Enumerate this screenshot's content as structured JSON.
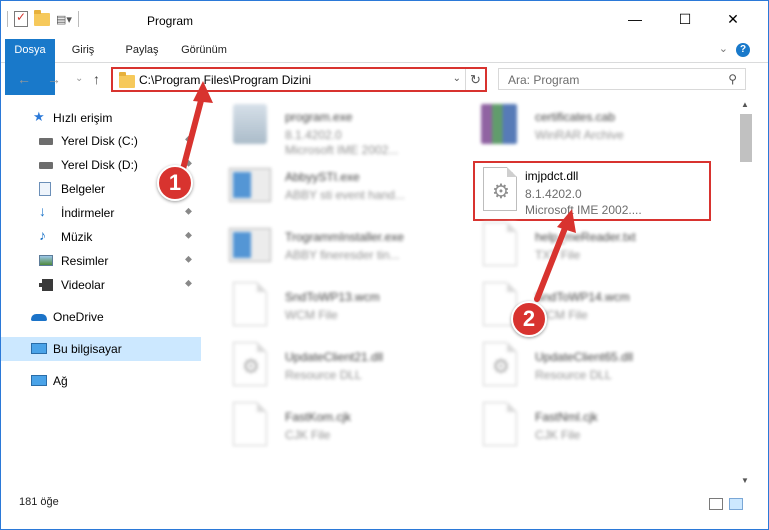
{
  "window": {
    "title": "Program",
    "minimize": "—",
    "maximize": "☐",
    "close": "✕"
  },
  "ribbon": {
    "tabs": [
      "Dosya",
      "Giriş",
      "Paylaş",
      "Görünüm"
    ],
    "help": "?",
    "collapse": "⌄"
  },
  "nav": {
    "back": "←",
    "forward": "→",
    "recent": "⌄",
    "up": "↑"
  },
  "address": {
    "path": "C:\\Program Files\\Program Dizini",
    "dropdown": "⌄",
    "refresh": "↻"
  },
  "search": {
    "placeholder": "Ara: Program",
    "icon": "⚲"
  },
  "sidebar": {
    "items": [
      {
        "label": "Hızlı erişim",
        "icon": "star-icon"
      },
      {
        "label": "Yerel Disk (C:)",
        "icon": "drive-icon"
      },
      {
        "label": "Yerel Disk (D:)",
        "icon": "drive-icon"
      },
      {
        "label": "Belgeler",
        "icon": "documents-icon"
      },
      {
        "label": "İndirmeler",
        "icon": "download-icon"
      },
      {
        "label": "Müzik",
        "icon": "music-icon"
      },
      {
        "label": "Resimler",
        "icon": "pictures-icon"
      },
      {
        "label": "Videolar",
        "icon": "videos-icon"
      },
      {
        "label": "OneDrive",
        "icon": "cloud-icon"
      },
      {
        "label": "Bu bilgisayar",
        "icon": "computer-icon"
      },
      {
        "label": "Ağ",
        "icon": "network-icon"
      }
    ],
    "pin": "📌"
  },
  "files": [
    {
      "name": "program.exe",
      "line1": "8.1.4202.0",
      "line2": "Microsoft IME 2002..."
    },
    {
      "name": "certificates.cab",
      "line1": "WinRAR Archive",
      "line2": ""
    },
    {
      "name": "AbbyySTI.exe",
      "line1": "ABBY sti event hand...",
      "line2": ""
    },
    {
      "name": "imjpdct.dll",
      "line1": "8.1.4202.0",
      "line2": "Microsoft IME 2002...."
    },
    {
      "name": "TrogrammInstaller.exe",
      "line1": "ABBY fineresder tin...",
      "line2": ""
    },
    {
      "name": "help_meReader.txt",
      "line1": "TXT File",
      "line2": ""
    },
    {
      "name": "SndToWP13.wcm",
      "line1": "WCM File",
      "line2": ""
    },
    {
      "name": "SndToWP14.wcm",
      "line1": "WCM File",
      "line2": ""
    },
    {
      "name": "UpdateClient21.dll",
      "line1": "Resource DLL",
      "line2": ""
    },
    {
      "name": "UpdateClient65.dll",
      "line1": "Resource DLL",
      "line2": ""
    },
    {
      "name": "FastKom.cjk",
      "line1": "CJK File",
      "line2": ""
    },
    {
      "name": "FastNml.cjk",
      "line1": "CJK File",
      "line2": ""
    }
  ],
  "status": {
    "count": "181 öğe"
  },
  "annotations": {
    "step1": "1",
    "step2": "2"
  },
  "colors": {
    "accent": "#1979ca",
    "highlight": "#d8332f",
    "selected": "#cce8ff"
  }
}
